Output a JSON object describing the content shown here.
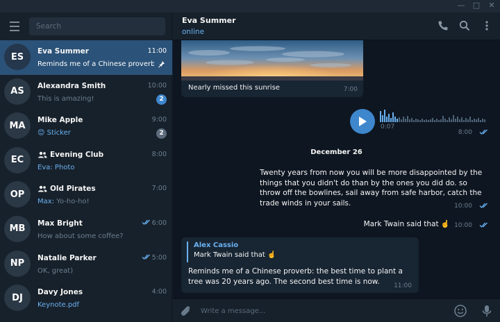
{
  "window": {
    "minimize": "—",
    "maximize": "□",
    "close": "✕"
  },
  "search": {
    "placeholder": "Search"
  },
  "chats": [
    {
      "initials": "ES",
      "name": "Eva Summer",
      "time": "11:00",
      "preview": "Reminds me of a Chinese proverb: the best time to plant a tree",
      "pinned": true,
      "active": true
    },
    {
      "initials": "AS",
      "name": "Alexandra Smith",
      "time": "10:00",
      "preview": "This is amazing!",
      "badge": "2"
    },
    {
      "initials": "MA",
      "name": "Mike Apple",
      "time": "9:00",
      "preview": "Sticker",
      "preview_emoji": "😊",
      "badge": "2"
    },
    {
      "initials": "EC",
      "name": "Evening Club",
      "time": "8:00",
      "preview": "Eva: Photo",
      "group": true
    },
    {
      "initials": "OP",
      "name": "Old Pirates",
      "time": "7:00",
      "preview_sender": "Max:",
      "preview": "Yo-ho-ho!",
      "group": true
    },
    {
      "initials": "MB",
      "name": "Max Bright",
      "time": "6:00",
      "preview": "How about some coffee?",
      "read": true
    },
    {
      "initials": "NP",
      "name": "Natalie Parker",
      "time": "5:00",
      "preview": "OK, great)",
      "read": true
    },
    {
      "initials": "DJ",
      "name": "Davy Jones",
      "time": "4:00",
      "preview": "Keynote.pdf"
    }
  ],
  "header": {
    "name": "Eva Summer",
    "status": "online"
  },
  "icons": {
    "phone": "phone-icon",
    "search": "search-icon",
    "more": "more-vertical-icon",
    "attach": "paperclip-icon",
    "emoji": "emoji-icon",
    "mic": "microphone-icon",
    "pin": "pin-icon"
  },
  "messages": {
    "photo": {
      "caption": "Nearly missed this sunrise",
      "time": "7:00"
    },
    "voice": {
      "duration": "0:07",
      "time": "8:00"
    },
    "date_separator": "December 26",
    "quote": {
      "text": "Twenty years from now you will be more disappointed by the things that you didn't do than by the ones you did do. so throw off the bowlines, sail away from safe harbor, catch the trade winds in your sails.",
      "time": "10:00"
    },
    "mark_twain": {
      "text": "Mark Twain said that ☝️",
      "time": "10:00"
    },
    "reply": {
      "author": "Alex Cassio",
      "quoted": "Mark Twain said that ☝️",
      "text": "Reminds me of a Chinese proverb: the best time to plant a tree was 20 years ago. The second best time is now.",
      "time": "11:00"
    }
  },
  "composer": {
    "placeholder": "Write a message..."
  },
  "colors": {
    "accent": "#3e87cd",
    "link": "#6ab2f2",
    "sidebar_bg": "#17212b",
    "chat_bg": "#0e1621",
    "active_row": "#2b5278"
  }
}
